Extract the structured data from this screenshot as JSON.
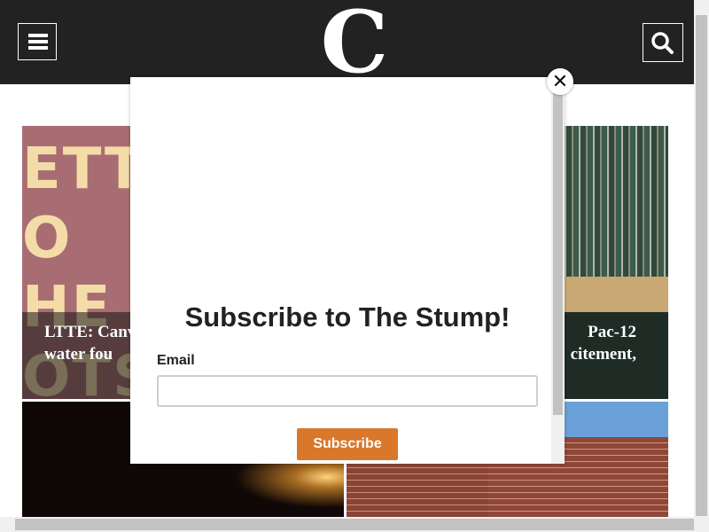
{
  "header": {
    "logo_text": "C",
    "menu_icon": "hamburger-menu-icon",
    "search_icon": "search-icon",
    "background": "#222222"
  },
  "tiles": [
    {
      "caption": "LTTE: Canv\nwater fou",
      "poster_text": "ETT\nO\nHE\nOTS"
    },
    {
      "caption": "Pac-12\ncitement,"
    },
    {},
    {}
  ],
  "modal": {
    "title": "Subscribe to The Stump!",
    "email_label": "Email",
    "email_value": "",
    "email_placeholder": "",
    "subscribe_label": "Subscribe",
    "close_label": "✕",
    "accent": "#d9772b"
  }
}
